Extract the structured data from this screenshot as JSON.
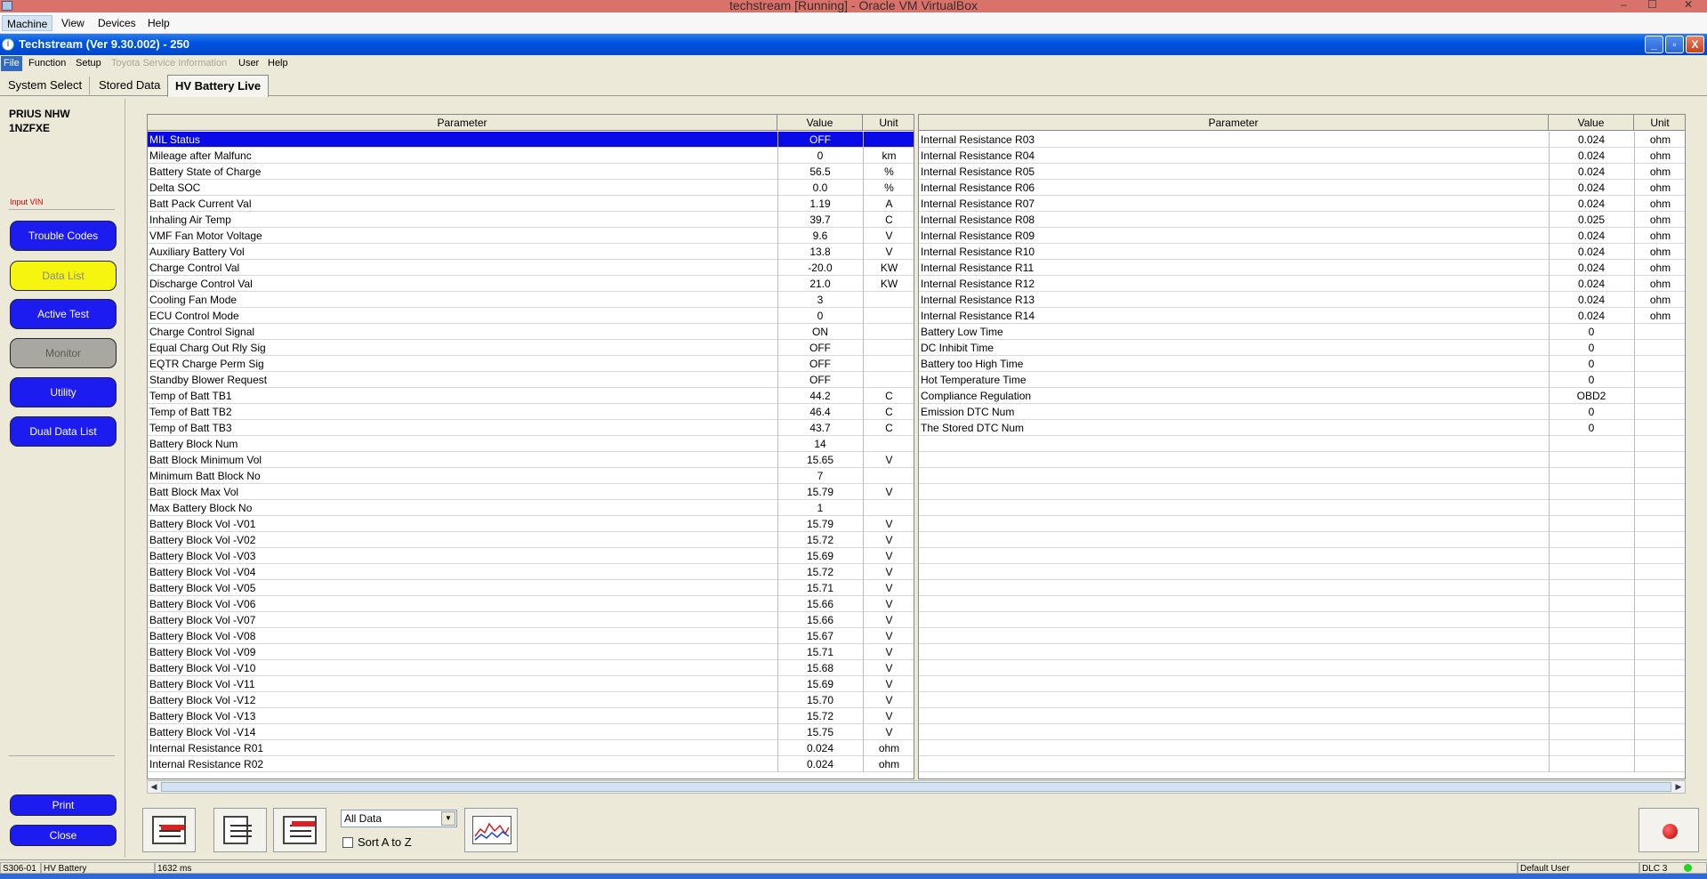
{
  "vm": {
    "title": "techstream [Running] - Oracle VM VirtualBox",
    "menu": [
      "Machine",
      "View",
      "Devices",
      "Help"
    ],
    "window_controls": [
      "–",
      "☐",
      "✕"
    ]
  },
  "app": {
    "title": "Techstream (Ver 9.30.002) - 250",
    "menu": [
      {
        "label": "File",
        "state": "selected"
      },
      {
        "label": "Function",
        "state": "normal"
      },
      {
        "label": "Setup",
        "state": "normal"
      },
      {
        "label": "Toyota Service Information",
        "state": "disabled"
      },
      {
        "label": "User",
        "state": "normal"
      },
      {
        "label": "Help",
        "state": "normal"
      }
    ],
    "window_controls": [
      "_",
      "▫",
      "X"
    ]
  },
  "tabs": [
    {
      "label": "System Select",
      "active": false
    },
    {
      "label": "Stored Data",
      "active": false
    },
    {
      "label": "HV Battery Live",
      "active": true
    }
  ],
  "sidebar": {
    "vehicle_line1": "PRIUS NHW",
    "vehicle_line2": "1NZFXE",
    "input_vin": "Input VIN",
    "buttons": [
      {
        "label": "Trouble Codes",
        "style": "blue"
      },
      {
        "label": "Data List",
        "style": "yellow"
      },
      {
        "label": "Active Test",
        "style": "blue"
      },
      {
        "label": "Monitor",
        "style": "gray"
      },
      {
        "label": "Utility",
        "style": "blue"
      },
      {
        "label": "Dual Data List",
        "style": "blue"
      }
    ],
    "print_label": "Print",
    "close_label": "Close"
  },
  "table_headers": {
    "parameter": "Parameter",
    "value": "Value",
    "unit": "Unit"
  },
  "left_rows": [
    [
      "MIL Status",
      "OFF",
      ""
    ],
    [
      "Mileage after Malfunc",
      "0",
      "km"
    ],
    [
      "Battery State of Charge",
      "56.5",
      "%"
    ],
    [
      "Delta SOC",
      "0.0",
      "%"
    ],
    [
      "Batt Pack Current Val",
      "1.19",
      "A"
    ],
    [
      "Inhaling Air Temp",
      "39.7",
      "C"
    ],
    [
      "VMF Fan Motor Voltage",
      "9.6",
      "V"
    ],
    [
      "Auxiliary Battery Vol",
      "13.8",
      "V"
    ],
    [
      "Charge Control Val",
      "-20.0",
      "KW"
    ],
    [
      "Discharge Control Val",
      "21.0",
      "KW"
    ],
    [
      "Cooling Fan Mode",
      "3",
      ""
    ],
    [
      "ECU Control Mode",
      "0",
      ""
    ],
    [
      "Charge Control Signal",
      "ON",
      ""
    ],
    [
      "Equal Charg Out Rly Sig",
      "OFF",
      ""
    ],
    [
      "EQTR Charge Perm Sig",
      "OFF",
      ""
    ],
    [
      "Standby Blower Request",
      "OFF",
      ""
    ],
    [
      "Temp of Batt TB1",
      "44.2",
      "C"
    ],
    [
      "Temp of Batt TB2",
      "46.4",
      "C"
    ],
    [
      "Temp of Batt TB3",
      "43.7",
      "C"
    ],
    [
      "Battery Block Num",
      "14",
      ""
    ],
    [
      "Batt Block Minimum Vol",
      "15.65",
      "V"
    ],
    [
      "Minimum Batt Block No",
      "7",
      ""
    ],
    [
      "Batt Block Max Vol",
      "15.79",
      "V"
    ],
    [
      "Max Battery Block No",
      "1",
      ""
    ],
    [
      "Battery Block Vol -V01",
      "15.79",
      "V"
    ],
    [
      "Battery Block Vol -V02",
      "15.72",
      "V"
    ],
    [
      "Battery Block Vol -V03",
      "15.69",
      "V"
    ],
    [
      "Battery Block Vol -V04",
      "15.72",
      "V"
    ],
    [
      "Battery Block Vol -V05",
      "15.71",
      "V"
    ],
    [
      "Battery Block Vol -V06",
      "15.66",
      "V"
    ],
    [
      "Battery Block Vol -V07",
      "15.66",
      "V"
    ],
    [
      "Battery Block Vol -V08",
      "15.67",
      "V"
    ],
    [
      "Battery Block Vol -V09",
      "15.71",
      "V"
    ],
    [
      "Battery Block Vol -V10",
      "15.68",
      "V"
    ],
    [
      "Battery Block Vol -V11",
      "15.69",
      "V"
    ],
    [
      "Battery Block Vol -V12",
      "15.70",
      "V"
    ],
    [
      "Battery Block Vol -V13",
      "15.72",
      "V"
    ],
    [
      "Battery Block Vol -V14",
      "15.75",
      "V"
    ],
    [
      "Internal Resistance R01",
      "0.024",
      "ohm"
    ],
    [
      "Internal Resistance R02",
      "0.024",
      "ohm"
    ]
  ],
  "right_rows": [
    [
      "Internal Resistance R03",
      "0.024",
      "ohm"
    ],
    [
      "Internal Resistance R04",
      "0.024",
      "ohm"
    ],
    [
      "Internal Resistance R05",
      "0.024",
      "ohm"
    ],
    [
      "Internal Resistance R06",
      "0.024",
      "ohm"
    ],
    [
      "Internal Resistance R07",
      "0.024",
      "ohm"
    ],
    [
      "Internal Resistance R08",
      "0.025",
      "ohm"
    ],
    [
      "Internal Resistance R09",
      "0.024",
      "ohm"
    ],
    [
      "Internal Resistance R10",
      "0.024",
      "ohm"
    ],
    [
      "Internal Resistance R11",
      "0.024",
      "ohm"
    ],
    [
      "Internal Resistance R12",
      "0.024",
      "ohm"
    ],
    [
      "Internal Resistance R13",
      "0.024",
      "ohm"
    ],
    [
      "Internal Resistance R14",
      "0.024",
      "ohm"
    ],
    [
      "Battery Low Time",
      "0",
      ""
    ],
    [
      "DC Inhibit Time",
      "0",
      ""
    ],
    [
      "Battery too High Time",
      "0",
      ""
    ],
    [
      "Hot Temperature Time",
      "0",
      ""
    ],
    [
      "Compliance Regulation",
      "OBD2",
      ""
    ],
    [
      "Emission DTC Num",
      "0",
      ""
    ],
    [
      "The Stored DTC Num",
      "0",
      ""
    ]
  ],
  "selected_row": "MIL Status",
  "toolbar": {
    "filter_value": "All Data",
    "sort_label": "Sort A to Z",
    "sort_checked": false
  },
  "status": {
    "code": "S306-01",
    "system": "HV Battery",
    "time": "1632 ms",
    "user": "Default User",
    "dlc": "DLC 3"
  },
  "colors": {
    "selected_row": "#0a0ae6",
    "button_blue": "#1c1cf0",
    "button_yellow": "#f5f50f",
    "button_gray": "#a8a8a0",
    "input_vin": "#dd0000",
    "dlc_led": "#1ed81e"
  }
}
